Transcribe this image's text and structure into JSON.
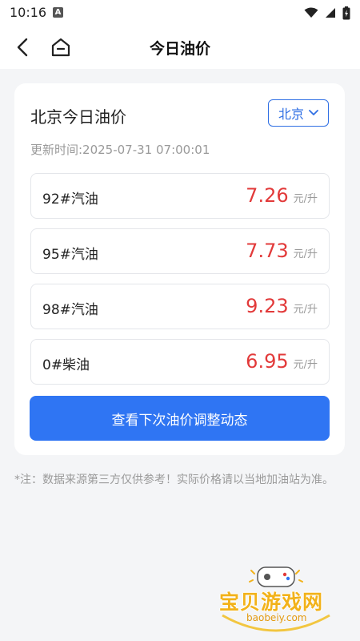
{
  "status": {
    "time": "10:16",
    "app_icon_letter": "A"
  },
  "header": {
    "title": "今日油价"
  },
  "card": {
    "title": "北京今日油价",
    "city": "北京",
    "update_time": "更新时间:2025-07-31 07:00:01",
    "prices": [
      {
        "name": "92#汽油",
        "price": "7.26",
        "unit": "元/升"
      },
      {
        "name": "95#汽油",
        "price": "7.73",
        "unit": "元/升"
      },
      {
        "name": "98#汽油",
        "price": "9.23",
        "unit": "元/升"
      },
      {
        "name": "0#柴油",
        "price": "6.95",
        "unit": "元/升"
      }
    ],
    "cta_label": "查看下次油价调整动态"
  },
  "note": "*注：数据来源第三方仅供参考！实际价格请以当地加油站为准。",
  "watermark": {
    "title": "宝贝游戏网",
    "url": "baobeiy.com"
  },
  "colors": {
    "accent": "#2f75f3",
    "price": "#e23a3a",
    "muted": "#9a9a9a",
    "background": "#f4f5f7"
  },
  "icons": {
    "back": "chevron-left-icon",
    "home": "home-icon",
    "city_dropdown": "chevron-down-icon",
    "wifi": "wifi-icon",
    "signal": "signal-icon",
    "battery": "battery-icon"
  }
}
